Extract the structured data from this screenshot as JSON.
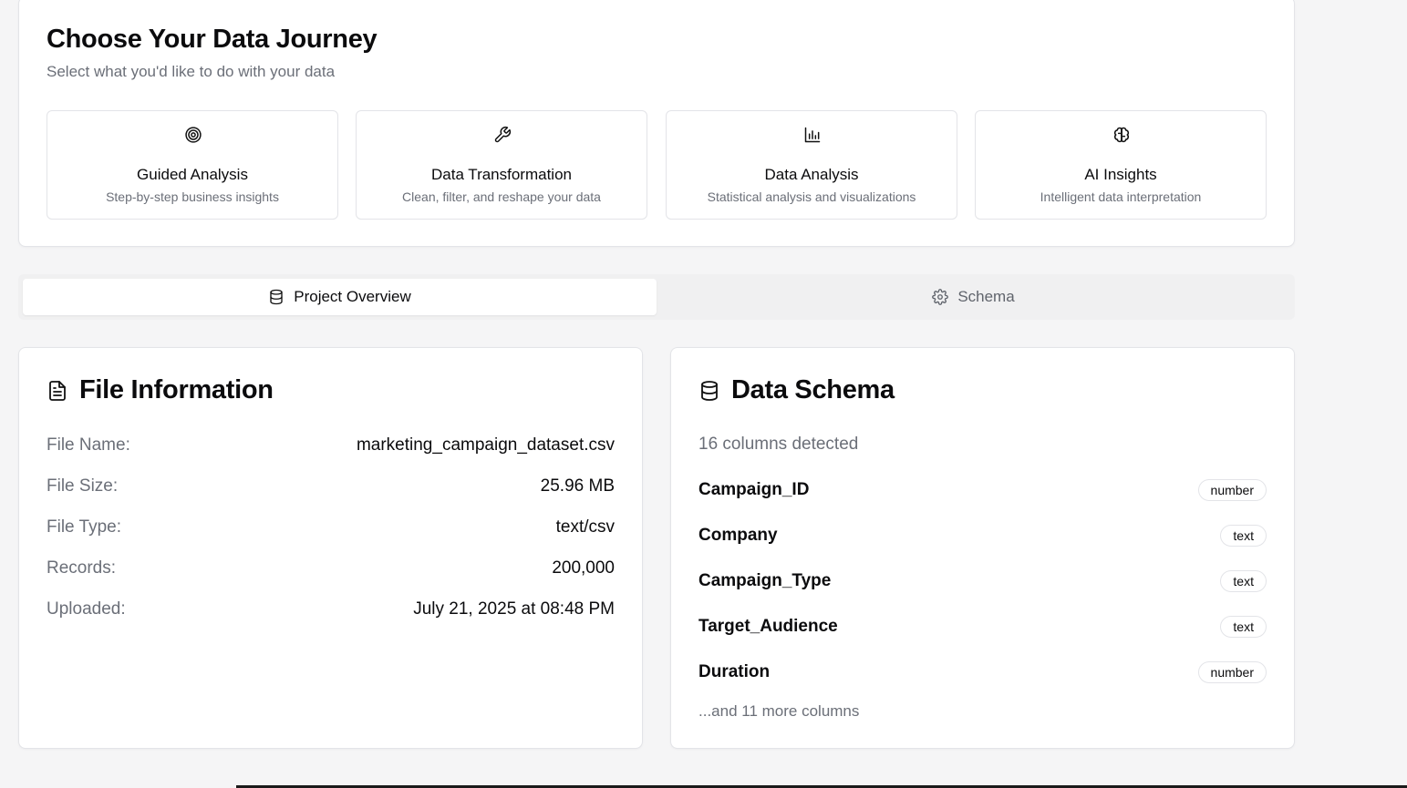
{
  "journey": {
    "title": "Choose Your Data Journey",
    "subtitle": "Select what you'd like to do with your data",
    "options": [
      {
        "icon": "target-icon",
        "label": "Guided Analysis",
        "description": "Step-by-step business insights"
      },
      {
        "icon": "wrench-icon",
        "label": "Data Transformation",
        "description": "Clean, filter, and reshape your data"
      },
      {
        "icon": "bar-chart-icon",
        "label": "Data Analysis",
        "description": "Statistical analysis and visualizations"
      },
      {
        "icon": "brain-icon",
        "label": "AI Insights",
        "description": "Intelligent data interpretation"
      }
    ]
  },
  "tabs": [
    {
      "icon": "database-icon",
      "label": "Project Overview",
      "active": true
    },
    {
      "icon": "gear-icon",
      "label": "Schema",
      "active": false
    }
  ],
  "file_info": {
    "title": "File Information",
    "rows": [
      {
        "label": "File Name:",
        "value": "marketing_campaign_dataset.csv"
      },
      {
        "label": "File Size:",
        "value": "25.96 MB"
      },
      {
        "label": "File Type:",
        "value": "text/csv"
      },
      {
        "label": "Records:",
        "value": "200,000"
      },
      {
        "label": "Uploaded:",
        "value": "July 21, 2025 at 08:48 PM"
      }
    ]
  },
  "schema": {
    "title": "Data Schema",
    "columns_detected": "16 columns detected",
    "columns": [
      {
        "name": "Campaign_ID",
        "type": "number"
      },
      {
        "name": "Company",
        "type": "text"
      },
      {
        "name": "Campaign_Type",
        "type": "text"
      },
      {
        "name": "Target_Audience",
        "type": "text"
      },
      {
        "name": "Duration",
        "type": "number"
      }
    ],
    "more": "...and 11 more columns"
  },
  "colors": {
    "background": "#f5f5f6",
    "card": "#ffffff",
    "border": "#e3e4e8",
    "muted_text": "#6b6f78",
    "tab_track": "#f0f0f1"
  }
}
